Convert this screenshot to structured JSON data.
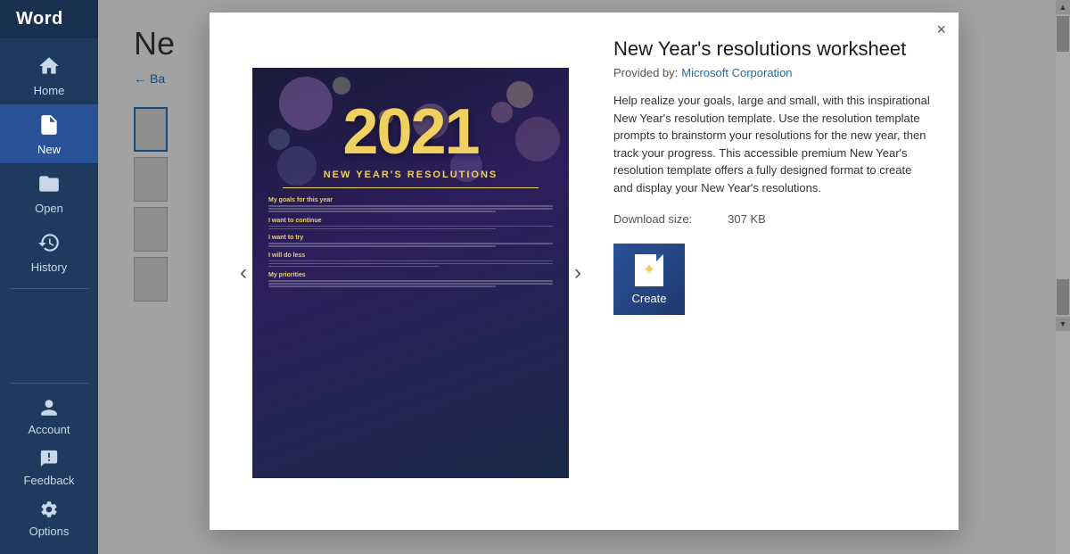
{
  "app": {
    "title": "Word"
  },
  "sidebar": {
    "items": [
      {
        "id": "home",
        "label": "Home",
        "icon": "home"
      },
      {
        "id": "new",
        "label": "New",
        "icon": "new-doc"
      },
      {
        "id": "open",
        "label": "Open",
        "icon": "folder"
      },
      {
        "id": "history",
        "label": "History",
        "icon": "history"
      }
    ],
    "bottom_items": [
      {
        "id": "account",
        "label": "Account",
        "icon": "account"
      },
      {
        "id": "feedback",
        "label": "Feedback",
        "icon": "feedback"
      },
      {
        "id": "options",
        "label": "Options",
        "icon": "options"
      }
    ]
  },
  "background": {
    "page_title": "Ne",
    "back_label": "Ba"
  },
  "modal": {
    "close_label": "×",
    "template": {
      "title": "New Year's resolutions worksheet",
      "provider_label": "Provided by:",
      "provider_name": "Microsoft Corporation",
      "description": "Help realize your goals, large and small, with this inspirational New Year's resolution template. Use the resolution template prompts to brainstorm your resolutions for the new year, then track your progress. This accessible premium New Year's resolution template offers a fully designed format to create and display your New Year's resolutions.",
      "download_label": "Download size:",
      "download_size": "307 KB",
      "create_label": "Create",
      "year": "2021",
      "subtitle": "NEW YEAR'S RESOLUTIONS",
      "sections": [
        {
          "title": "My goals for this year",
          "lines": [
            "Write your goals here. Need help? Try to make your goal as specific as you can. The more specific",
            "and concrete your goal is (i.e., \"lose five pounds by March 15,\") the more you're likely to achieve it."
          ]
        },
        {
          "title": "I want to continue",
          "lines": [
            "Write your goal here. Need help? Make your goal around something important to you. Is your health",
            "important? Conquering a fear? Think about goals that can positively shape your life."
          ]
        },
        {
          "title": "I want to try",
          "lines": [
            "Write your goal here. Need help? Try to break your large goal into smaller ones. Smaller goals can be",
            "a good starting point if your main goal feels overwhelming."
          ]
        },
        {
          "title": "I will do less",
          "lines": [
            "Write your goal here. Need help? Try to make your goal measurable. Track your progress in a journal",
            "or phone app. Observing your progression over time through pictures or data can be a great",
            "motivational tool."
          ]
        },
        {
          "title": "My priorities",
          "lines": [
            "Write your goal here. Need help? Think about how much time you can set aside each day or week by",
            "creating a timeline. Plan a reasonable time to complete your goal. Schedule a buffer for yourself so it",
            "takes longer than expected."
          ]
        }
      ]
    }
  }
}
